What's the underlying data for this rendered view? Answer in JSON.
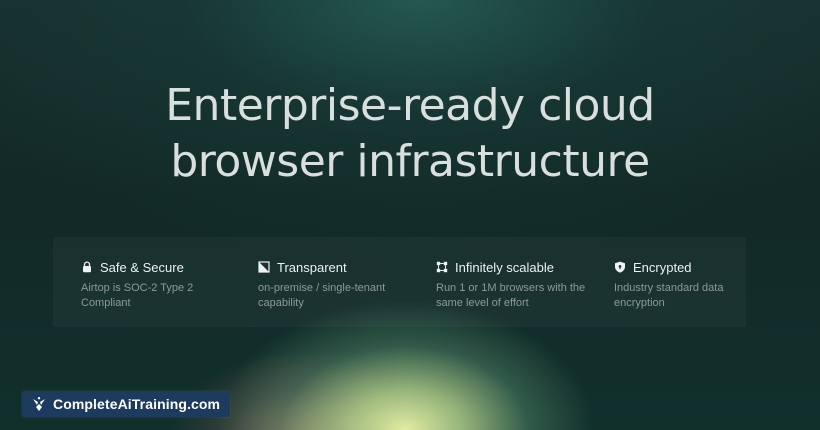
{
  "hero": {
    "line1": "Enterprise-ready cloud",
    "line2": "browser infrastructure"
  },
  "features": [
    {
      "icon": "lock-icon",
      "title": "Safe & Secure",
      "line1": "Airtop is SOC-2 Type 2",
      "line2": "Compliant"
    },
    {
      "icon": "transparent-icon",
      "title": "Transparent",
      "line1": "on-premise / single-tenant",
      "line2": "capability"
    },
    {
      "icon": "scale-icon",
      "title": "Infinitely scalable",
      "line1": "Run 1 or 1M browsers with the",
      "line2": "same level of effort"
    },
    {
      "icon": "shield-icon",
      "title": "Encrypted",
      "line1": "Industry standard data",
      "line2": "encryption"
    }
  ],
  "badge": {
    "icon": "sparkle-logo-icon",
    "text": "CompleteAiTraining.com"
  },
  "colors": {
    "background": "#122826",
    "headline": "#d9dfdc",
    "badge": "#1d3a5f",
    "glow": "#ecf6a8"
  }
}
